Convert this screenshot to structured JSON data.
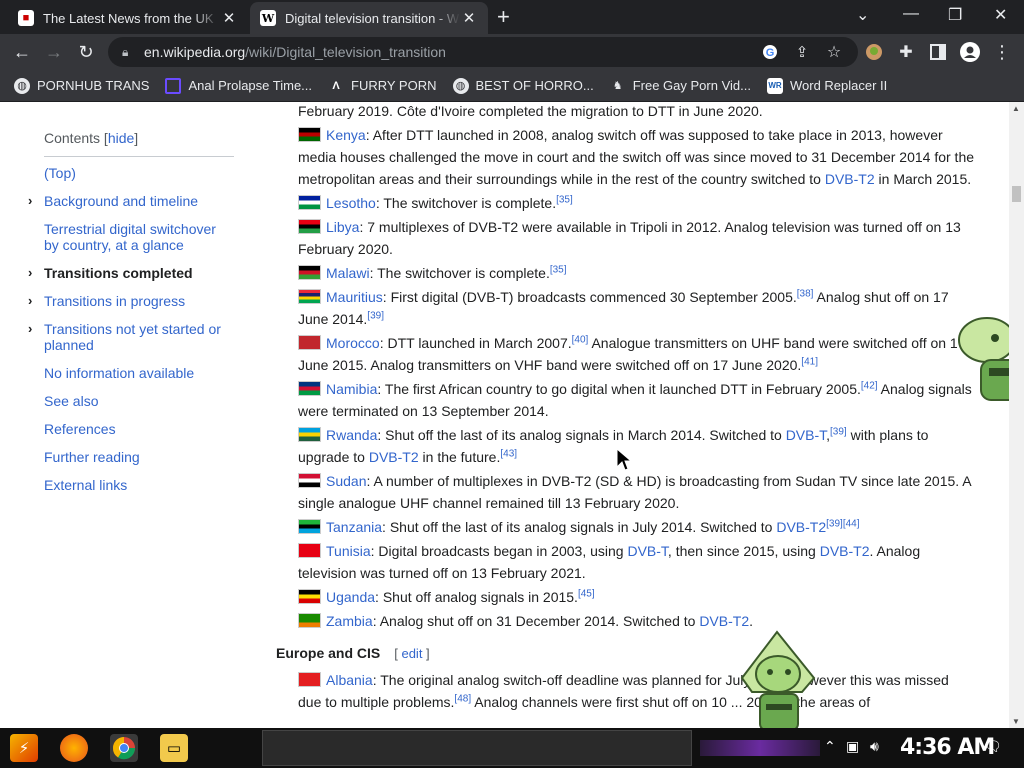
{
  "tabs": [
    {
      "title": "The Latest News from the UK",
      "favicon": "news-favicon",
      "active": false
    },
    {
      "title": "Digital television transition - W",
      "favicon": "wikipedia-favicon",
      "active": true
    }
  ],
  "address": {
    "host": "en.wikipedia.org",
    "path": "/wiki/Digital_television_transition"
  },
  "bookmarks": [
    "PORNHUB TRANS",
    "Anal Prolapse Time...",
    "FURRY PORN",
    "BEST OF HORRO...",
    "Free Gay Porn Vid...",
    "Word Replacer II"
  ],
  "toc": {
    "heading": "Contents",
    "hide": "hide",
    "items": [
      {
        "label": "(Top)",
        "chevron": false,
        "bold": false
      },
      {
        "label": "Background and timeline",
        "chevron": true,
        "bold": false
      },
      {
        "label": "Terrestrial digital switchover by country, at a glance",
        "chevron": false,
        "bold": false
      },
      {
        "label": "Transitions completed",
        "chevron": true,
        "bold": true
      },
      {
        "label": "Transitions in progress",
        "chevron": true,
        "bold": false
      },
      {
        "label": "Transitions not yet started or planned",
        "chevron": true,
        "bold": false
      },
      {
        "label": "No information available",
        "chevron": false,
        "bold": false
      },
      {
        "label": "See also",
        "chevron": false,
        "bold": false
      },
      {
        "label": "References",
        "chevron": false,
        "bold": false
      },
      {
        "label": "Further reading",
        "chevron": false,
        "bold": false
      },
      {
        "label": "External links",
        "chevron": false,
        "bold": false
      }
    ]
  },
  "content": {
    "top_fragment": "February 2019. Côte d'Ivoire completed the migration to DTT in June 2020.",
    "entries": [
      {
        "country": "Kenya",
        "flag": [
          "#000000",
          "#bb0000",
          "#006600"
        ],
        "segments": [
          {
            "t": ": After DTT launched in 2008, analog switch off was supposed to take place in 2013, however media houses challenged the move in court and the switch off was since moved to 31 December 2014 for the metropolitan areas and their surroundings while in the rest of the country switched to "
          },
          {
            "l": "DVB-T2"
          },
          {
            "t": " in March 2015."
          }
        ]
      },
      {
        "country": "Lesotho",
        "flag": [
          "#00209f",
          "#ffffff",
          "#009543"
        ],
        "segments": [
          {
            "t": ": The switchover is complete."
          },
          {
            "s": "[35]"
          }
        ]
      },
      {
        "country": "Libya",
        "flag": [
          "#e70013",
          "#000000",
          "#239e46"
        ],
        "segments": [
          {
            "t": ": 7 multiplexes of DVB-T2 were available in Tripoli in 2012. Analog television was turned off on 13 February 2020."
          }
        ]
      },
      {
        "country": "Malawi",
        "flag": [
          "#000000",
          "#ce1126",
          "#339e35"
        ],
        "segments": [
          {
            "t": ": The switchover is complete."
          },
          {
            "s": "[35]"
          }
        ]
      },
      {
        "country": "Mauritius",
        "flag": [
          "#ea2839",
          "#1a206d",
          "#ffd500",
          "#00a551"
        ],
        "segments": [
          {
            "t": ": First digital (DVB-T) broadcasts commenced 30 September 2005."
          },
          {
            "s": "[38]"
          },
          {
            "t": " Analog shut off on 17 June 2014."
          },
          {
            "s": "[39]"
          }
        ]
      },
      {
        "country": "Morocco",
        "flag": [
          "#c1272d",
          "#c1272d",
          "#c1272d"
        ],
        "segments": [
          {
            "t": ": DTT launched in March 2007."
          },
          {
            "s": "[40]"
          },
          {
            "t": " Analogue transmitters on UHF band were switched off on 17 June 2015. Analog transmitters on VHF band were switched off on 17 June 2020."
          },
          {
            "s": "[41]"
          }
        ]
      },
      {
        "country": "Namibia",
        "flag": [
          "#003580",
          "#d21034",
          "#009a44"
        ],
        "segments": [
          {
            "t": ": The first African country to go digital when it launched DTT in February 2005."
          },
          {
            "s": "[42]"
          },
          {
            "t": " Analog signals were terminated on 13 September 2014."
          }
        ]
      },
      {
        "country": "Rwanda",
        "flag": [
          "#00a1de",
          "#fad201",
          "#20603d"
        ],
        "segments": [
          {
            "t": ": Shut off the last of its analog signals in March 2014. Switched to "
          },
          {
            "l": "DVB-T"
          },
          {
            "t": ","
          },
          {
            "s": "[39]"
          },
          {
            "t": " with plans to upgrade to "
          },
          {
            "l": "DVB-T2"
          },
          {
            "t": " in the future."
          },
          {
            "s": "[43]"
          }
        ]
      },
      {
        "country": "Sudan",
        "flag": [
          "#d21034",
          "#ffffff",
          "#000000"
        ],
        "segments": [
          {
            "t": ": A number of multiplexes in DVB-T2 (SD & HD) is broadcasting from Sudan TV since late 2015. A single analogue UHF channel remained till 13 February 2020."
          }
        ]
      },
      {
        "country": "Tanzania",
        "flag": [
          "#1eb53a",
          "#000000",
          "#00a3dd"
        ],
        "segments": [
          {
            "t": ": Shut off the last of its analog signals in July 2014. Switched to "
          },
          {
            "l": "DVB-T2"
          },
          {
            "s": "[39][44]"
          }
        ]
      },
      {
        "country": "Tunisia",
        "flag": [
          "#e70013",
          "#e70013",
          "#e70013"
        ],
        "segments": [
          {
            "t": ": Digital broadcasts began in 2003, using "
          },
          {
            "l": "DVB-T"
          },
          {
            "t": ", then since 2015, using "
          },
          {
            "l": "DVB-T2"
          },
          {
            "t": ". Analog television was turned off on 13 February 2021."
          }
        ]
      },
      {
        "country": "Uganda",
        "flag": [
          "#000000",
          "#fcdc04",
          "#d90000"
        ],
        "segments": [
          {
            "t": ": Shut off analog signals in 2015."
          },
          {
            "s": "[45]"
          }
        ]
      },
      {
        "country": "Zambia",
        "flag": [
          "#198a00",
          "#198a00",
          "#ef7d00"
        ],
        "segments": [
          {
            "t": ": Analog shut off on 31 December 2014. Switched to "
          },
          {
            "l": "DVB-T2"
          },
          {
            "t": "."
          }
        ]
      }
    ],
    "section": {
      "title": "Europe and CIS",
      "edit": "edit"
    },
    "next_entries": [
      {
        "country": "Albania",
        "flag": [
          "#e41e20",
          "#e41e20",
          "#e41e20"
        ],
        "segments": [
          {
            "t": ": The original analog switch-off deadline was planned for July 2012, however this was missed due to multiple problems."
          },
          {
            "s": "[48]"
          },
          {
            "t": " Analog channels were first shut off on 10 ... 2018 in the areas of"
          }
        ]
      }
    ]
  },
  "taskbar": {
    "clock": "4:36 AM"
  }
}
